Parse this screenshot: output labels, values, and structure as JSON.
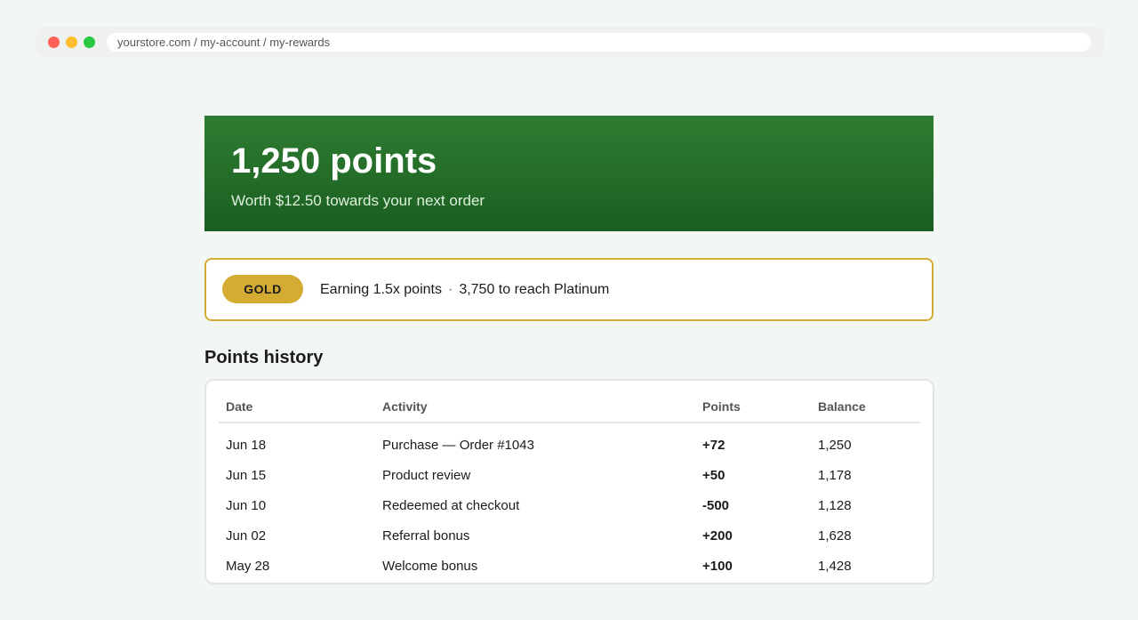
{
  "browser": {
    "url": "yourstore.com / my-account / my-rewards"
  },
  "hero": {
    "points": "1,250 points",
    "subtitle": "Worth $12.50 towards your next order"
  },
  "tier": {
    "badge": "GOLD",
    "earning": "Earning 1.5x points",
    "separator": "·",
    "next_tier": "3,750 to reach Platinum"
  },
  "history": {
    "title": "Points history",
    "columns": [
      "Date",
      "Activity",
      "Points",
      "Balance"
    ],
    "rows": [
      {
        "date": "Jun 18",
        "activity": "Purchase — Order #1043",
        "points": "+72",
        "balance": "1,250"
      },
      {
        "date": "Jun 15",
        "activity": "Product review",
        "points": "+50",
        "balance": "1,178"
      },
      {
        "date": "Jun 10",
        "activity": "Redeemed at checkout",
        "points": "-500",
        "balance": "1,128"
      },
      {
        "date": "Jun 02",
        "activity": "Referral bonus",
        "points": "+200",
        "balance": "1,628"
      },
      {
        "date": "May 28",
        "activity": "Welcome bonus",
        "points": "+100",
        "balance": "1,428"
      }
    ]
  },
  "colors": {
    "brand_green": "#2e7d32",
    "gold": "#d4ac34",
    "negative": "#c62828"
  }
}
